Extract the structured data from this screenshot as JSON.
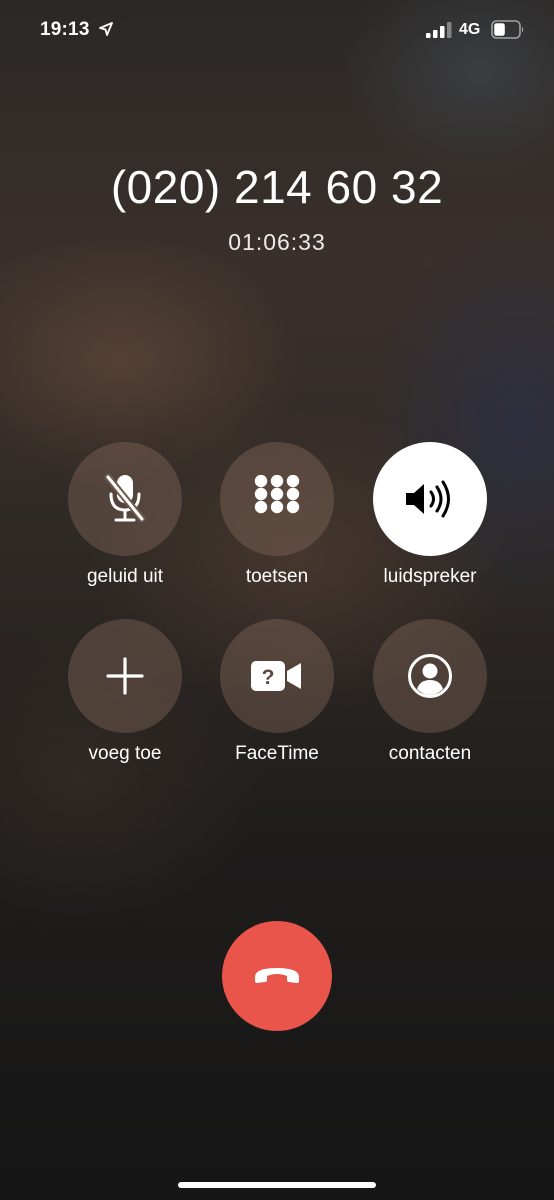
{
  "status_bar": {
    "time": "19:13",
    "location_icon": "location-arrow-icon",
    "signal_icon": "cellular-signal-icon",
    "network": "4G",
    "battery_icon": "battery-icon",
    "battery_level": 0.45
  },
  "call": {
    "number": "(020) 214 60 32",
    "duration": "01:06:33"
  },
  "controls": [
    {
      "label": "geluid uit",
      "icon": "microphone-muted-icon",
      "active": false
    },
    {
      "label": "toetsen",
      "icon": "keypad-icon",
      "active": false
    },
    {
      "label": "luidspreker",
      "icon": "speaker-icon",
      "active": true
    },
    {
      "label": "voeg toe",
      "icon": "plus-icon",
      "active": false
    },
    {
      "label": "FaceTime",
      "icon": "facetime-icon",
      "active": false
    },
    {
      "label": "contacten",
      "icon": "contact-icon",
      "active": false
    }
  ],
  "end_call": {
    "icon": "phone-hangup-icon",
    "color": "#e9544b"
  },
  "colors": {
    "active_button": "#ffffff",
    "end_call": "#e9544b"
  }
}
